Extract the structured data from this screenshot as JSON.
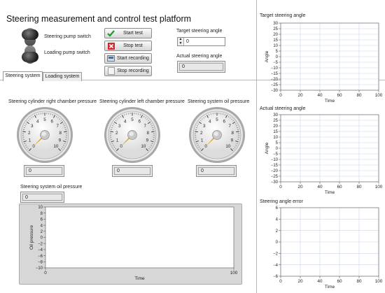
{
  "app": {
    "title": "Steering measurement and control test platform"
  },
  "switches": [
    {
      "label": "Steering pump switch"
    },
    {
      "label": "Loading pump switch"
    }
  ],
  "buttons": {
    "start_test": "Start test",
    "stop_test": "Stop test",
    "start_recording": "Start recording",
    "stop_recording": "Stop recording"
  },
  "target_angle": {
    "label": "Target steering angle",
    "value": "0"
  },
  "actual_angle": {
    "label": "Actual steering angle",
    "value": "0"
  },
  "tabs": [
    {
      "label": "Steering system"
    },
    {
      "label": "Loading system"
    }
  ],
  "gauges": [
    {
      "label": "Steering cylinder right chamber pressure",
      "value": "0",
      "reading": 0
    },
    {
      "label": "Steering cylinder left chamber pressure",
      "value": "0",
      "reading": 0
    },
    {
      "label": "Steering system oil pressure",
      "value": "0",
      "reading": 0
    }
  ],
  "gauge_scale": {
    "min": 0,
    "max": 10,
    "ticks": [
      "0",
      "1",
      "2",
      "3",
      "4",
      "5",
      "6",
      "7",
      "8",
      "9",
      "10"
    ]
  },
  "oil_pressure_readout": {
    "label": "Steering system oil pressure",
    "value": "0"
  },
  "chart_data": [
    {
      "id": "oil",
      "type": "line",
      "title": "",
      "xlabel": "Time",
      "ylabel": "Oil pressure",
      "xlim": [
        0,
        100
      ],
      "ylim": [
        -10,
        10
      ],
      "xticks": [
        0,
        100
      ],
      "yticks": [
        10,
        8,
        6,
        4,
        2,
        0,
        -2,
        -4,
        -6,
        -8,
        -10
      ],
      "grid": false,
      "series": []
    },
    {
      "id": "target",
      "type": "line",
      "title": "Target steering angle",
      "xlabel": "Time",
      "ylabel": "Angle",
      "xlim": [
        0,
        100
      ],
      "ylim": [
        -30,
        30
      ],
      "xticks": [
        0,
        20,
        40,
        60,
        80,
        100
      ],
      "yticks": [
        30,
        25,
        20,
        15,
        10,
        5,
        0,
        -5,
        -10,
        -15,
        -20,
        -25,
        -30
      ],
      "grid": true,
      "series": []
    },
    {
      "id": "actual",
      "type": "line",
      "title": "Actual steering angle",
      "xlabel": "Time",
      "ylabel": "Angle",
      "xlim": [
        0,
        100
      ],
      "ylim": [
        -30,
        30
      ],
      "xticks": [
        0,
        20,
        40,
        60,
        80,
        100
      ],
      "yticks": [
        30,
        25,
        20,
        15,
        10,
        5,
        0,
        -5,
        -10,
        -15,
        -20,
        -25,
        -30
      ],
      "grid": true,
      "series": []
    },
    {
      "id": "error",
      "type": "line",
      "title": "Steering angle error",
      "xlabel": "Time",
      "ylabel": "",
      "xlim": [
        0,
        100
      ],
      "ylim": [
        -6,
        6
      ],
      "xticks": [
        0,
        20,
        40,
        60,
        80,
        100
      ],
      "yticks": [
        6,
        4,
        2,
        0,
        -2,
        -4,
        -6
      ],
      "grid": true,
      "series": []
    }
  ],
  "colors": {
    "grid": "#c9d3ee",
    "needle": "#e0a428",
    "plot_bg": "#ffffff",
    "frame": "#d8d8d8"
  }
}
